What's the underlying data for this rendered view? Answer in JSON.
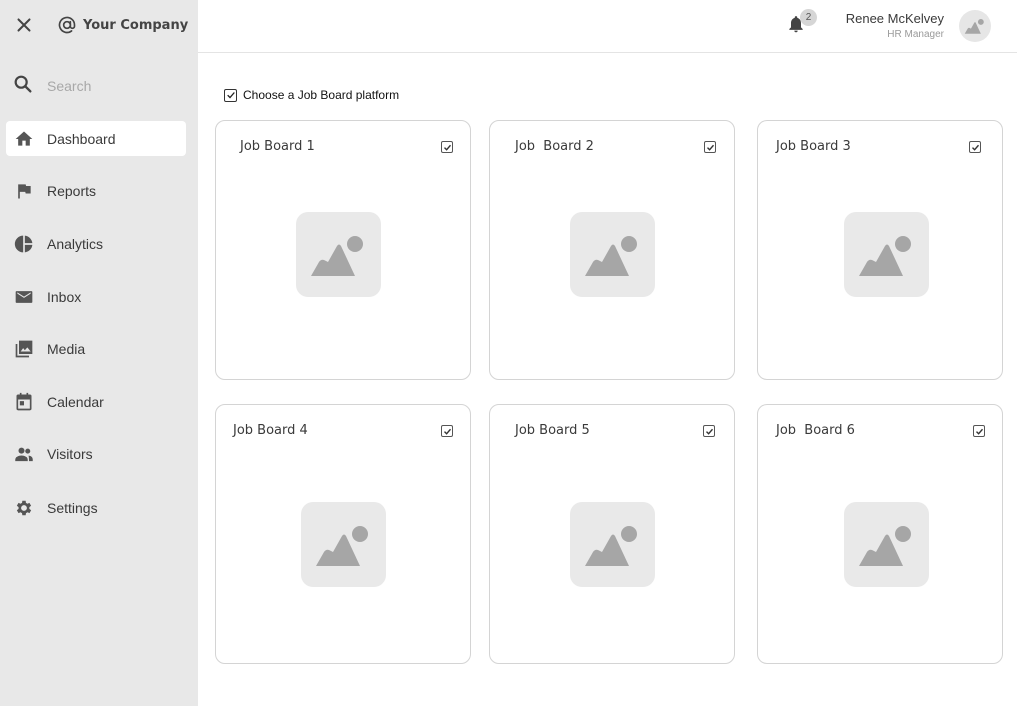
{
  "sidebar": {
    "company": "Your Company",
    "search_placeholder": "Search",
    "items": [
      {
        "label": "Dashboard",
        "icon": "home-icon",
        "active": true
      },
      {
        "label": "Reports",
        "icon": "flag-icon"
      },
      {
        "label": "Analytics",
        "icon": "pie-chart-icon"
      },
      {
        "label": "Inbox",
        "icon": "mail-icon"
      },
      {
        "label": "Media",
        "icon": "photo-library-icon"
      },
      {
        "label": "Calendar",
        "icon": "calendar-icon"
      },
      {
        "label": "Visitors",
        "icon": "people-icon"
      },
      {
        "label": "Settings",
        "icon": "gear-icon"
      }
    ]
  },
  "header": {
    "notification_count": "2",
    "user_name": "Renee McKelvey",
    "user_role": "HR Manager"
  },
  "main": {
    "choose_label": "Choose a Job Board platform",
    "choose_checked": true,
    "boards": [
      {
        "title": "Job Board 1",
        "checked": true
      },
      {
        "title": "Job  Board 2",
        "checked": true
      },
      {
        "title": "Job Board 3",
        "checked": true
      },
      {
        "title": "Job Board 4",
        "checked": true
      },
      {
        "title": "Job Board 5",
        "checked": true
      },
      {
        "title": "Job  Board 6",
        "checked": true
      }
    ]
  },
  "colors": {
    "sidebar_bg": "#e8e8e8",
    "icon": "#555555",
    "placeholder_img": "#a6a6a6"
  }
}
